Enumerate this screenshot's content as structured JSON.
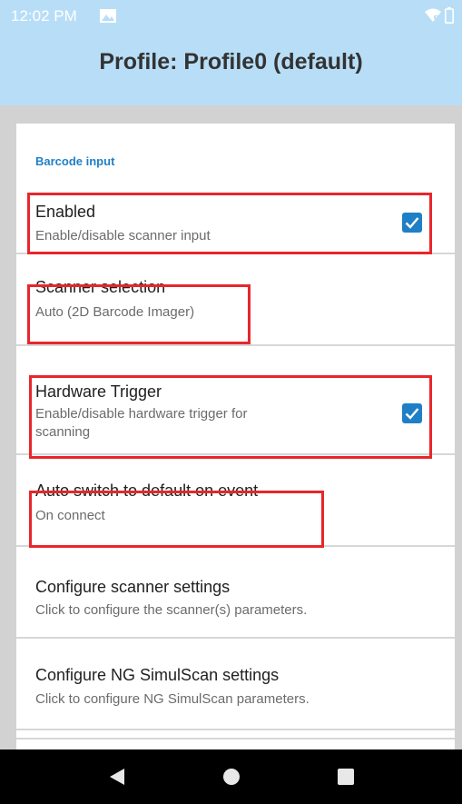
{
  "status_bar": {
    "time": "12:02 PM",
    "icons": [
      "image-icon",
      "wifi-icon",
      "battery-icon"
    ]
  },
  "app_bar": {
    "title": "Profile: Profile0 (default)"
  },
  "section": {
    "header": "Barcode input"
  },
  "preferences": [
    {
      "title": "Enabled",
      "summary": "Enable/disable scanner input",
      "checked": true,
      "highlighted": true
    },
    {
      "title": "Scanner selection",
      "summary": "Auto (2D Barcode Imager)",
      "highlighted": true
    },
    {
      "title": "Hardware Trigger",
      "summary_line1": "Enable/disable hardware trigger for",
      "summary_line2": "scanning",
      "checked": true,
      "highlighted": true
    },
    {
      "title": "Auto switch to default on event",
      "summary": "On connect",
      "highlighted": true
    },
    {
      "title": "Configure scanner settings",
      "summary": "Click to configure the scanner(s) parameters."
    },
    {
      "title": "Configure NG SimulScan settings",
      "summary": "Click to configure NG SimulScan parameters."
    }
  ],
  "nav_bar": {
    "buttons": [
      "back-icon",
      "home-icon",
      "recents-icon"
    ]
  },
  "colors": {
    "app_bar": "#b8def7",
    "accent": "#1f7fc6",
    "highlight": "#e8262b",
    "nav_bar": "#000000"
  }
}
